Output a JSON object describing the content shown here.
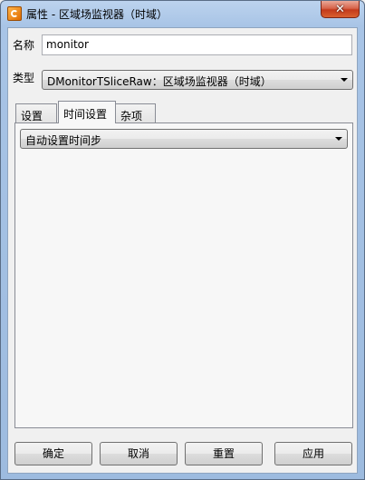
{
  "window": {
    "title": "属性 - 区域场监视器（时域）",
    "close_glyph": "✕"
  },
  "fields": {
    "name_label": "名称",
    "name_value": "monitor",
    "type_label": "类型",
    "type_value": "DMonitorTSliceRaw：区域场监视器（时域）"
  },
  "tabs": [
    {
      "label": "设置"
    },
    {
      "label": "时间设置"
    },
    {
      "label": "杂项"
    }
  ],
  "panel": {
    "time_mode_value": "自动设置时间步"
  },
  "buttons": {
    "ok": "确定",
    "cancel": "取消",
    "reset": "重置",
    "apply": "应用"
  }
}
